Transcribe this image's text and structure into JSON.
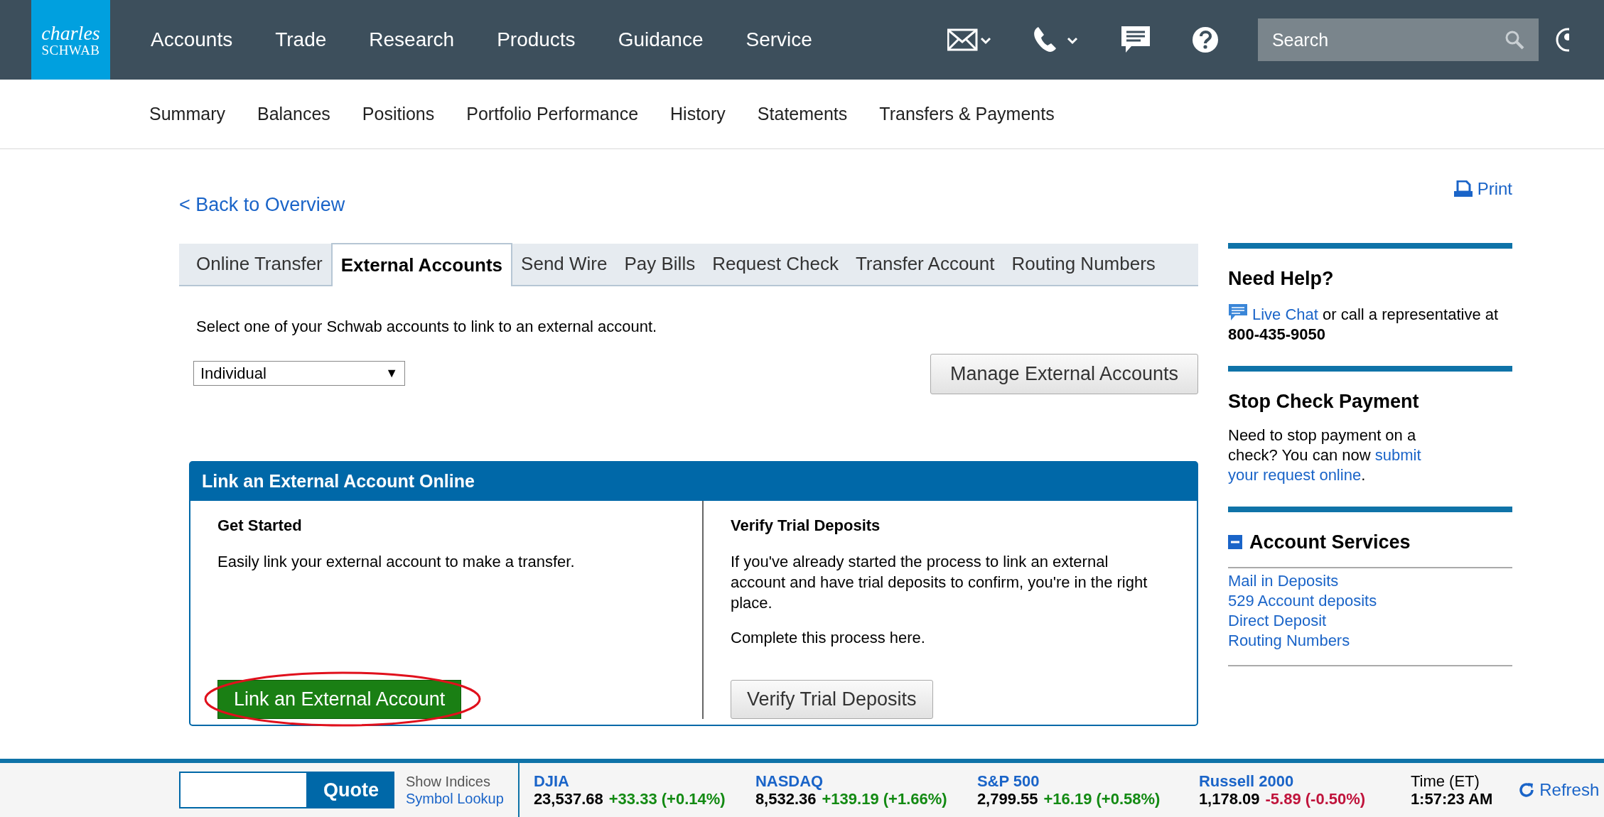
{
  "logo": {
    "line1": "charles",
    "line2": "SCHWAB"
  },
  "nav": [
    "Accounts",
    "Trade",
    "Research",
    "Products",
    "Guidance",
    "Service"
  ],
  "search": {
    "placeholder": "Search"
  },
  "subnav": [
    "Summary",
    "Balances",
    "Positions",
    "Portfolio Performance",
    "History",
    "Statements",
    "Transfers & Payments"
  ],
  "back_link": "< Back to Overview",
  "print": "Print",
  "tabs": [
    {
      "label": "Online Transfer",
      "selected": false
    },
    {
      "label": "External Accounts",
      "selected": true
    },
    {
      "label": "Send Wire",
      "selected": false
    },
    {
      "label": "Pay Bills",
      "selected": false
    },
    {
      "label": "Request Check",
      "selected": false
    },
    {
      "label": "Transfer Account",
      "selected": false
    },
    {
      "label": "Routing Numbers",
      "selected": false
    }
  ],
  "instruction": "Select one of your Schwab accounts to link to an external account.",
  "account_select": {
    "value": "Individual",
    "arrow": "▼"
  },
  "manage_button": "Manage External Accounts",
  "panel": {
    "title": "Link an External Account Online",
    "columns": [
      {
        "heading": "Get Started",
        "paragraphs": [
          "Easily link your external account to make a transfer."
        ],
        "button": "Link an External Account",
        "kind": "primary",
        "circled": true
      },
      {
        "heading": "Verify Trial Deposits",
        "paragraphs": [
          "If you've already started the process to link an external account and have trial deposits to confirm, you're in the right place.",
          "Complete this process here."
        ],
        "button": "Verify Trial Deposits",
        "kind": "secondary",
        "circled": false
      }
    ]
  },
  "sidebar": {
    "help": {
      "title": "Need Help?",
      "chat_link": "Live Chat",
      "text": "or call a representative at",
      "phone": "800-435-9050"
    },
    "stop_check": {
      "title": "Stop Check Payment",
      "text": "Need to stop payment on a check? You can now",
      "links": [
        "submit",
        "your request online"
      ],
      "end": "."
    },
    "services": {
      "title": "Account Services",
      "expanded": true,
      "links": [
        "Mail in Deposits",
        "529 Account deposits",
        "Direct Deposit",
        "Routing Numbers"
      ]
    }
  },
  "footer": {
    "quote_button": "Quote",
    "show_indices": "Show Indices",
    "symbol_lookup": "Symbol Lookup",
    "indices": [
      {
        "name": "DJIA",
        "value": "23,537.68",
        "change": "+33.33 (+0.14%)",
        "color": "#138a13"
      },
      {
        "name": "NASDAQ",
        "value": "8,532.36",
        "change": "+139.19 (+1.66%)",
        "color": "#138a13"
      },
      {
        "name": "S&P 500",
        "value": "2,799.55",
        "change": "+16.19 (+0.58%)",
        "color": "#138a13"
      },
      {
        "name": "Russell 2000",
        "value": "1,178.09",
        "change": "-5.89 (-0.50%)",
        "color": "#c0143c"
      }
    ],
    "time_label": "Time (ET)",
    "time": "1:57:23 AM",
    "refresh": "Refresh"
  }
}
